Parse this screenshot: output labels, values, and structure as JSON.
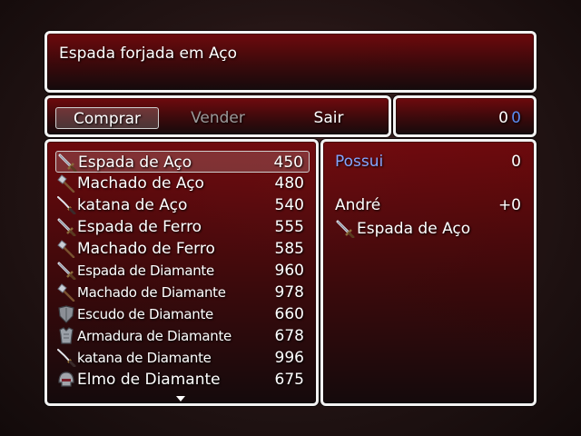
{
  "help": {
    "text": "Espada forjada em Aço"
  },
  "commands": [
    {
      "label": "Comprar"
    },
    {
      "label": "Vender"
    },
    {
      "label": "Sair"
    }
  ],
  "gold": {
    "value": "0",
    "currency": "0"
  },
  "items": [
    {
      "name": "Espada de Aço",
      "price": "450",
      "icon": "sword-icon"
    },
    {
      "name": "Machado de Aço",
      "price": "480",
      "icon": "axe-icon"
    },
    {
      "name": "katana de Aço",
      "price": "540",
      "icon": "katana-icon"
    },
    {
      "name": "Espada de Ferro",
      "price": "555",
      "icon": "sword-icon"
    },
    {
      "name": "Machado de Ferro",
      "price": "585",
      "icon": "axe-icon"
    },
    {
      "name": "Espada de Diamante",
      "price": "960",
      "icon": "sword-icon"
    },
    {
      "name": "Machado de Diamante",
      "price": "978",
      "icon": "axe-icon"
    },
    {
      "name": "Escudo de Diamante",
      "price": "660",
      "icon": "shield-icon"
    },
    {
      "name": "Armadura de Diamante",
      "price": "678",
      "icon": "armor-icon"
    },
    {
      "name": "katana de Diamante",
      "price": "996",
      "icon": "katana-icon"
    },
    {
      "name": "Elmo de Diamante",
      "price": "675",
      "icon": "helmet-icon"
    }
  ],
  "status": {
    "possess_label": "Possui",
    "possess_value": "0",
    "actor_name": "André",
    "param_change": "+0",
    "equipped_item": "Espada de Aço",
    "equipped_icon": "sword-icon"
  }
}
